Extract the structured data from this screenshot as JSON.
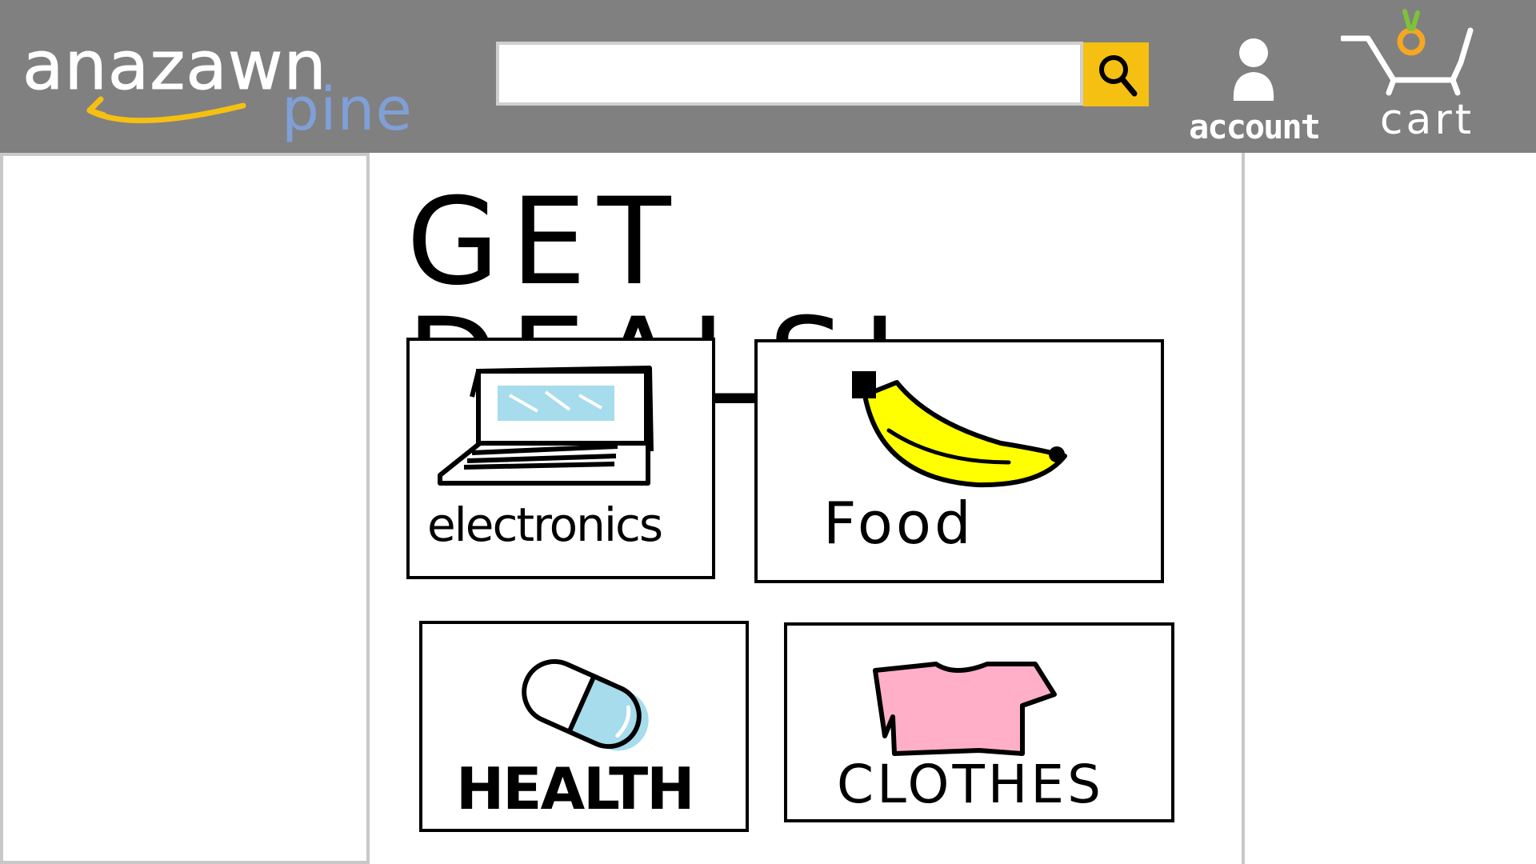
{
  "header": {
    "logo": {
      "main": "anazawn",
      "sub": "pine"
    },
    "search": {
      "value": "",
      "placeholder": ""
    },
    "account_label": "account",
    "cart_label": "cart"
  },
  "main": {
    "title": "GET DEALS!",
    "categories": [
      {
        "label": "electronics",
        "icon": "laptop-icon"
      },
      {
        "label": "Food",
        "icon": "banana-icon"
      },
      {
        "label": "HEALTH",
        "icon": "pill-icon"
      },
      {
        "label": "CLOTHES",
        "icon": "shirt-icon"
      }
    ]
  },
  "colors": {
    "header_bg": "#808080",
    "search_button": "#f5c012",
    "logo_arrow": "#f5c012",
    "logo_sub": "#7f9fd6",
    "cart_fruit": "#f5a623",
    "cart_leaves": "#7ec23a",
    "banana": "#ffff00",
    "pill": "#a6dceb",
    "shirt": "#ffb0c8",
    "screen": "#a6dceb"
  }
}
